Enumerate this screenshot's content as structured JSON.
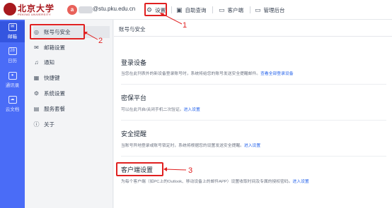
{
  "header": {
    "logo_text": "北京大学",
    "logo_subtitle": "PEKING UNIVERSITY",
    "avatar_letter": "a",
    "email": "@stu.pku.edu.cn",
    "nav": [
      {
        "icon": "gear-icon",
        "label": "设置"
      },
      {
        "icon": "calendar-icon",
        "label": "自助查询"
      },
      {
        "icon": "monitor-icon",
        "label": "客户端"
      },
      {
        "icon": "monitor-icon",
        "label": "管理后台"
      }
    ]
  },
  "leftnav": {
    "items": [
      {
        "icon": "mail-icon",
        "label": "邮箱"
      },
      {
        "icon": "calendar-icon",
        "label": "日历"
      },
      {
        "icon": "contacts-icon",
        "label": "通讯录"
      },
      {
        "icon": "cloud-icon",
        "label": "云文档"
      }
    ]
  },
  "settings_nav": {
    "items": [
      {
        "icon": "user-icon",
        "label": "账号与安全"
      },
      {
        "icon": "mail-icon",
        "label": "邮箱设置"
      },
      {
        "icon": "bell-icon",
        "label": "通知"
      },
      {
        "icon": "keyboard-icon",
        "label": "快捷键"
      },
      {
        "icon": "gear-icon",
        "label": "系统设置"
      },
      {
        "icon": "service-icon",
        "label": "服务套餐"
      },
      {
        "icon": "info-icon",
        "label": "关于"
      }
    ]
  },
  "main": {
    "title": "账号与安全",
    "sections": [
      {
        "title": "登录设备",
        "desc": "当您在此列表外的新设备登录账号时，系统将给您的账号发送安全提醒邮件。",
        "link": "查看全部登录设备"
      },
      {
        "title": "密保平台",
        "desc": "可以在此开启/关闭手机二次验证。",
        "link": "进入设置"
      },
      {
        "title": "安全提醒",
        "desc": "当账号异地登录或账号锁定时，系统将根据您的设置发送安全提醒。",
        "link": "进入设置"
      },
      {
        "title": "客户端设置",
        "desc": "为每个客户端（如PC上的Outlook、移动设备上的邮件APP）设置收取时间及专属的授权密码。",
        "link": "进入设置"
      }
    ]
  },
  "annotations": [
    "1",
    "2",
    "3"
  ],
  "colors": {
    "accent": "#4a6cf7",
    "annotation": "#e02020",
    "link": "#2563eb"
  }
}
